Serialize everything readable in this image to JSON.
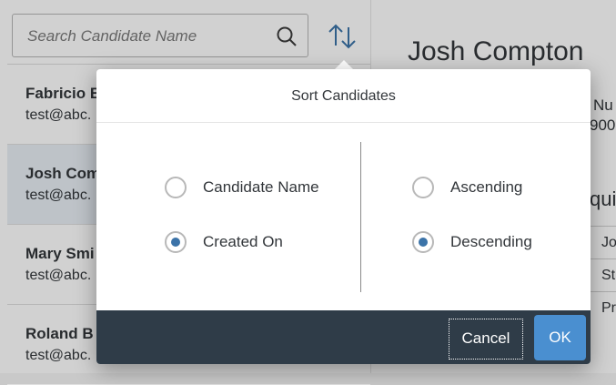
{
  "search": {
    "placeholder": "Search Candidate Name"
  },
  "candidates": [
    {
      "name": "Fabricio B",
      "email": "test@abc."
    },
    {
      "name": "Josh Com",
      "email": "test@abc."
    },
    {
      "name": "Mary Smi",
      "email": "test@abc."
    },
    {
      "name": "Roland B",
      "email": "test@abc."
    }
  ],
  "detail": {
    "title": "Josh Compton",
    "frag_nu": "Nu",
    "frag_900": "900",
    "frag_uis": "quis",
    "table_cells": [
      "Jo",
      "St",
      "Pr"
    ]
  },
  "dialog": {
    "title": "Sort Candidates",
    "sort_by": [
      {
        "label": "Candidate Name",
        "checked": false
      },
      {
        "label": "Created On",
        "checked": true
      }
    ],
    "order": [
      {
        "label": "Ascending",
        "checked": false
      },
      {
        "label": "Descending",
        "checked": true
      }
    ],
    "cancel_label": "Cancel",
    "ok_label": "OK"
  },
  "colors": {
    "accent": "#3b73a8",
    "ok_button": "#4a8fd0",
    "footer": "#2f3c48"
  }
}
